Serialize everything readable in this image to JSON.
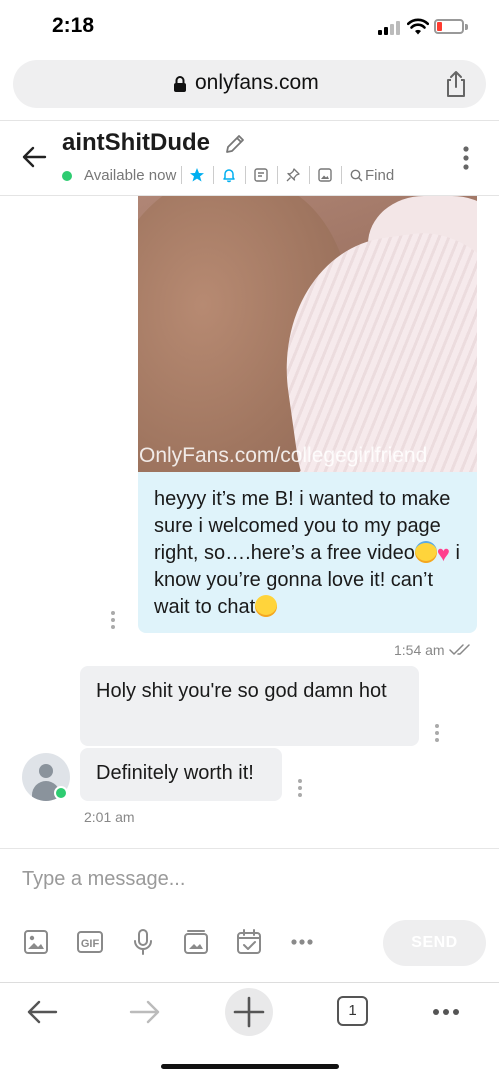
{
  "status_bar": {
    "time": "2:18"
  },
  "browser": {
    "url": "onlyfans.com",
    "tab_count": "1"
  },
  "chat": {
    "name": "aintShitDude",
    "status": "Available now",
    "find_label": "Find"
  },
  "messages": {
    "outgoing": {
      "watermark": "OnlyFans.com/collegegirlfriend",
      "text_part1": "heyyy it’s me B! i wanted to make sure i welcomed you to my page right, so….here’s a free video",
      "text_part2": " i know you’re gonna love it! can’t wait to chat",
      "time": "1:54 am"
    },
    "incoming": [
      {
        "text": "Holy shit you're so god damn hot"
      },
      {
        "text": "Definitely worth it!"
      }
    ],
    "incoming_time": "2:01 am"
  },
  "compose": {
    "placeholder": "Type a message...",
    "send_label": "SEND",
    "tools": [
      "image-icon",
      "gif-icon",
      "microphone-icon",
      "media-vault-icon",
      "schedule-icon",
      "more-icon"
    ]
  },
  "colors": {
    "outgoing_bubble": "#dff3fa",
    "incoming_bubble": "#eff0f2",
    "accent_blue": "#00aff0",
    "online_green": "#2ecc71"
  }
}
